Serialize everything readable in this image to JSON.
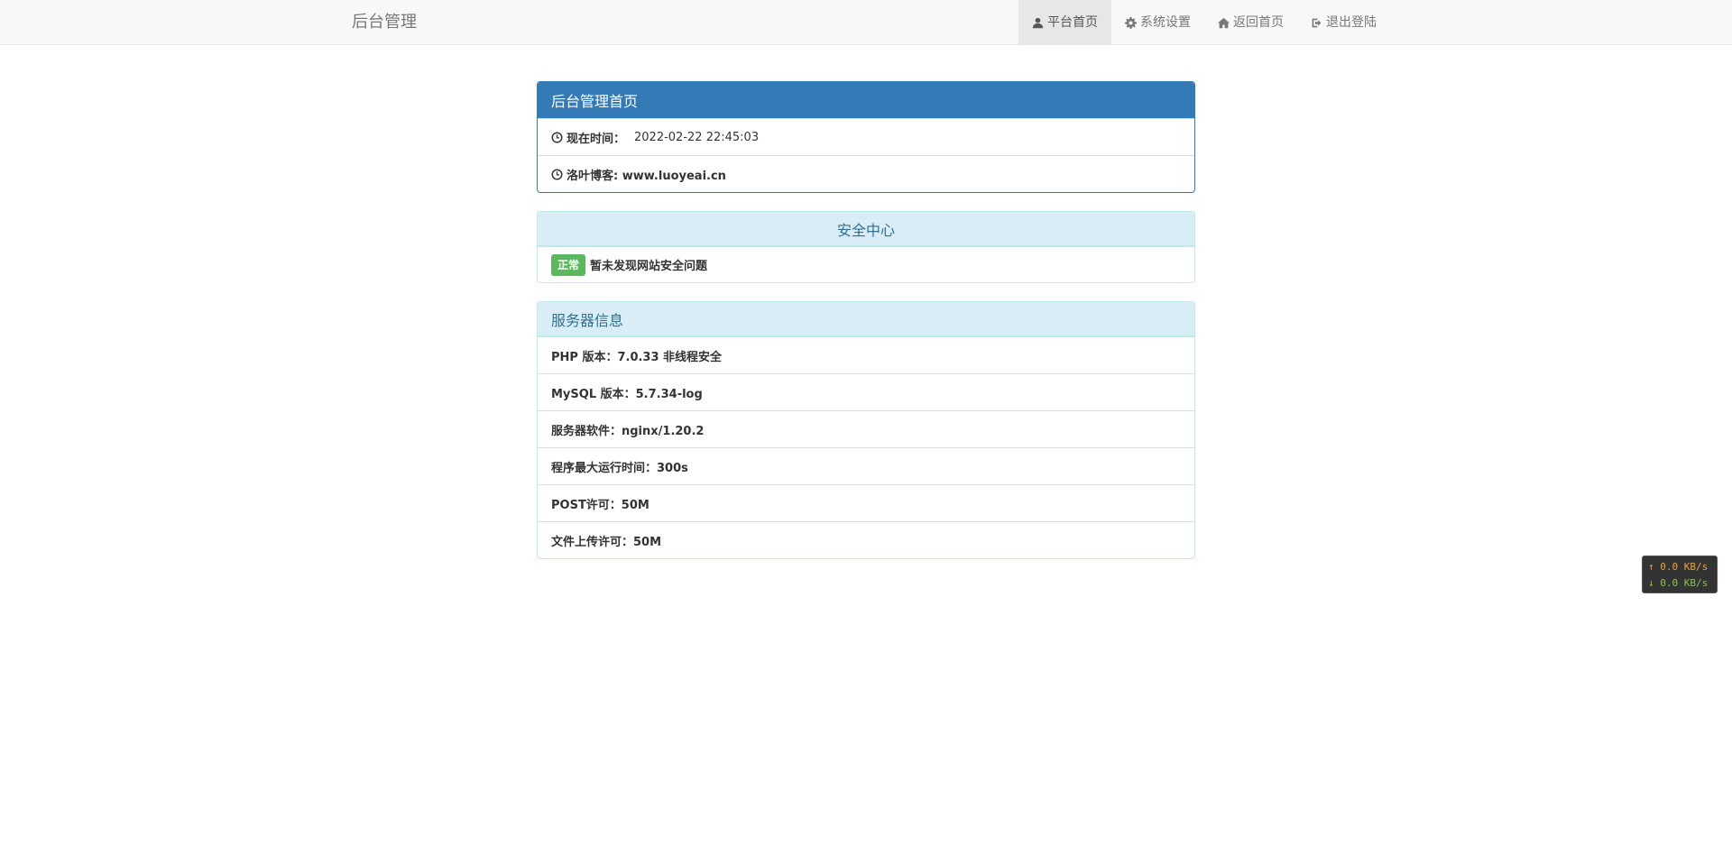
{
  "navbar": {
    "brand": "后台管理",
    "items": [
      {
        "label": "平台首页",
        "icon": "user-icon",
        "active": true
      },
      {
        "label": "系统设置",
        "icon": "gear-icon",
        "active": false
      },
      {
        "label": "返回首页",
        "icon": "home-icon",
        "active": false
      },
      {
        "label": "退出登陆",
        "icon": "logout-icon",
        "active": false
      }
    ]
  },
  "home_panel": {
    "title": "后台管理首页",
    "time_label": "现在时间：",
    "time_value": "2022-02-22 22:45:03",
    "blog_text": "洛叶博客: www.luoyeai.cn"
  },
  "security_panel": {
    "title": "安全中心",
    "status_badge": "正常",
    "status_text": "暂未发现网站安全问题",
    "badge_color": "#5cb85c"
  },
  "server_panel": {
    "title": "服务器信息",
    "rows": [
      "PHP 版本：7.0.33 非线程安全",
      "MySQL 版本：5.7.34-log",
      "服务器软件：nginx/1.20.2",
      "程序最大运行时间：300s",
      "POST许可：50M",
      "文件上传许可：50M"
    ]
  },
  "speed_widget": {
    "up": "↑ 0.0 KB/s",
    "down": "↓ 0.0 KB/s"
  },
  "colors": {
    "primary": "#337ab7",
    "info_bg": "#d9edf7",
    "info_text": "#31708f"
  }
}
